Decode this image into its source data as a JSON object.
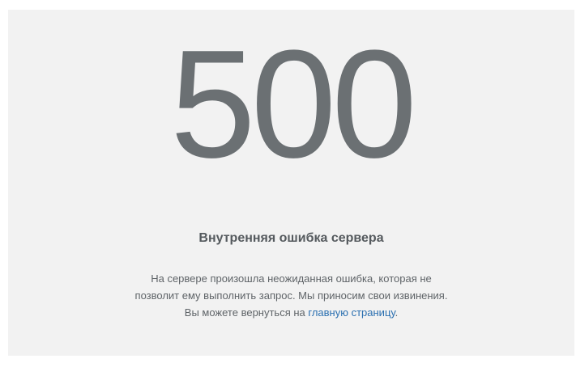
{
  "error": {
    "code": "500",
    "title": "Внутренняя ошибка сервера",
    "message_line1": "На сервере произошла неожиданная ошибка, которая не",
    "message_line2": "позволит ему выполнить запрос. Мы приносим свои извинения.",
    "message_line3_prefix": "Вы можете вернуться на ",
    "home_link_text": "главную страницу",
    "message_line3_suffix": "."
  },
  "colors": {
    "panel_background": "#f2f2f2",
    "code_color": "#6b7073",
    "text_color": "#5f6468",
    "link_color": "#2a6fb0"
  }
}
